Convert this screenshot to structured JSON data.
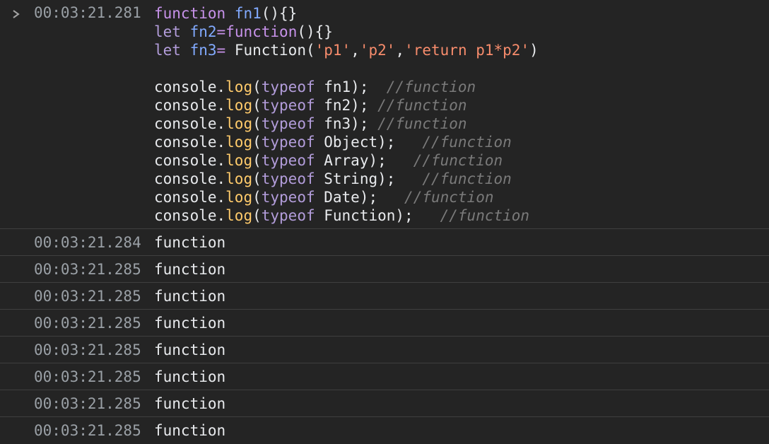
{
  "input": {
    "prompt_icon": "chevron-right-icon",
    "timestamp": "00:03:21.281",
    "lines": [
      [
        {
          "t": "function",
          "c": "kw"
        },
        {
          "t": " ",
          "c": "plain"
        },
        {
          "t": "fn1",
          "c": "fnname"
        },
        {
          "t": "(){}",
          "c": "plain"
        }
      ],
      [
        {
          "t": "let",
          "c": "kw2"
        },
        {
          "t": " ",
          "c": "plain"
        },
        {
          "t": "fn2",
          "c": "fnname"
        },
        {
          "t": "=",
          "c": "op"
        },
        {
          "t": "function",
          "c": "kw"
        },
        {
          "t": "(){}",
          "c": "plain"
        }
      ],
      [
        {
          "t": "let",
          "c": "kw2"
        },
        {
          "t": " ",
          "c": "plain"
        },
        {
          "t": "fn3",
          "c": "fnname"
        },
        {
          "t": "= ",
          "c": "op"
        },
        {
          "t": "Function(",
          "c": "plain"
        },
        {
          "t": "'p1'",
          "c": "str"
        },
        {
          "t": ",",
          "c": "plain"
        },
        {
          "t": "'p2'",
          "c": "str"
        },
        {
          "t": ",",
          "c": "plain"
        },
        {
          "t": "'return p1*p2'",
          "c": "str"
        },
        {
          "t": ")",
          "c": "plain"
        }
      ],
      [],
      [
        {
          "t": "console.",
          "c": "plain"
        },
        {
          "t": "log",
          "c": "method"
        },
        {
          "t": "(",
          "c": "plain"
        },
        {
          "t": "typeof",
          "c": "kw2"
        },
        {
          "t": " fn1);  ",
          "c": "plain"
        },
        {
          "t": "//function",
          "c": "cmt"
        }
      ],
      [
        {
          "t": "console.",
          "c": "plain"
        },
        {
          "t": "log",
          "c": "method"
        },
        {
          "t": "(",
          "c": "plain"
        },
        {
          "t": "typeof",
          "c": "kw2"
        },
        {
          "t": " fn2); ",
          "c": "plain"
        },
        {
          "t": "//function",
          "c": "cmt"
        }
      ],
      [
        {
          "t": "console.",
          "c": "plain"
        },
        {
          "t": "log",
          "c": "method"
        },
        {
          "t": "(",
          "c": "plain"
        },
        {
          "t": "typeof",
          "c": "kw2"
        },
        {
          "t": " fn3); ",
          "c": "plain"
        },
        {
          "t": "//function",
          "c": "cmt"
        }
      ],
      [
        {
          "t": "console.",
          "c": "plain"
        },
        {
          "t": "log",
          "c": "method"
        },
        {
          "t": "(",
          "c": "plain"
        },
        {
          "t": "typeof",
          "c": "kw2"
        },
        {
          "t": " Object);   ",
          "c": "plain"
        },
        {
          "t": "//function",
          "c": "cmt"
        }
      ],
      [
        {
          "t": "console.",
          "c": "plain"
        },
        {
          "t": "log",
          "c": "method"
        },
        {
          "t": "(",
          "c": "plain"
        },
        {
          "t": "typeof",
          "c": "kw2"
        },
        {
          "t": " Array);   ",
          "c": "plain"
        },
        {
          "t": "//function",
          "c": "cmt"
        }
      ],
      [
        {
          "t": "console.",
          "c": "plain"
        },
        {
          "t": "log",
          "c": "method"
        },
        {
          "t": "(",
          "c": "plain"
        },
        {
          "t": "typeof",
          "c": "kw2"
        },
        {
          "t": " String);   ",
          "c": "plain"
        },
        {
          "t": "//function",
          "c": "cmt"
        }
      ],
      [
        {
          "t": "console.",
          "c": "plain"
        },
        {
          "t": "log",
          "c": "method"
        },
        {
          "t": "(",
          "c": "plain"
        },
        {
          "t": "typeof",
          "c": "kw2"
        },
        {
          "t": " Date);   ",
          "c": "plain"
        },
        {
          "t": "//function",
          "c": "cmt"
        }
      ],
      [
        {
          "t": "console.",
          "c": "plain"
        },
        {
          "t": "log",
          "c": "method"
        },
        {
          "t": "(",
          "c": "plain"
        },
        {
          "t": "typeof",
          "c": "kw2"
        },
        {
          "t": " Function);   ",
          "c": "plain"
        },
        {
          "t": "//function",
          "c": "cmt"
        }
      ]
    ]
  },
  "outputs": [
    {
      "timestamp": "00:03:21.284",
      "value": "function"
    },
    {
      "timestamp": "00:03:21.285",
      "value": "function"
    },
    {
      "timestamp": "00:03:21.285",
      "value": "function"
    },
    {
      "timestamp": "00:03:21.285",
      "value": "function"
    },
    {
      "timestamp": "00:03:21.285",
      "value": "function"
    },
    {
      "timestamp": "00:03:21.285",
      "value": "function"
    },
    {
      "timestamp": "00:03:21.285",
      "value": "function"
    },
    {
      "timestamp": "00:03:21.285",
      "value": "function"
    }
  ],
  "colors": {
    "background": "#242424",
    "keyword": "#c792ea",
    "function_name": "#82aaff",
    "string": "#f78c6c",
    "method": "#ffcb6b",
    "comment": "#7a7a7a",
    "timestamp": "#9aa0a6"
  }
}
